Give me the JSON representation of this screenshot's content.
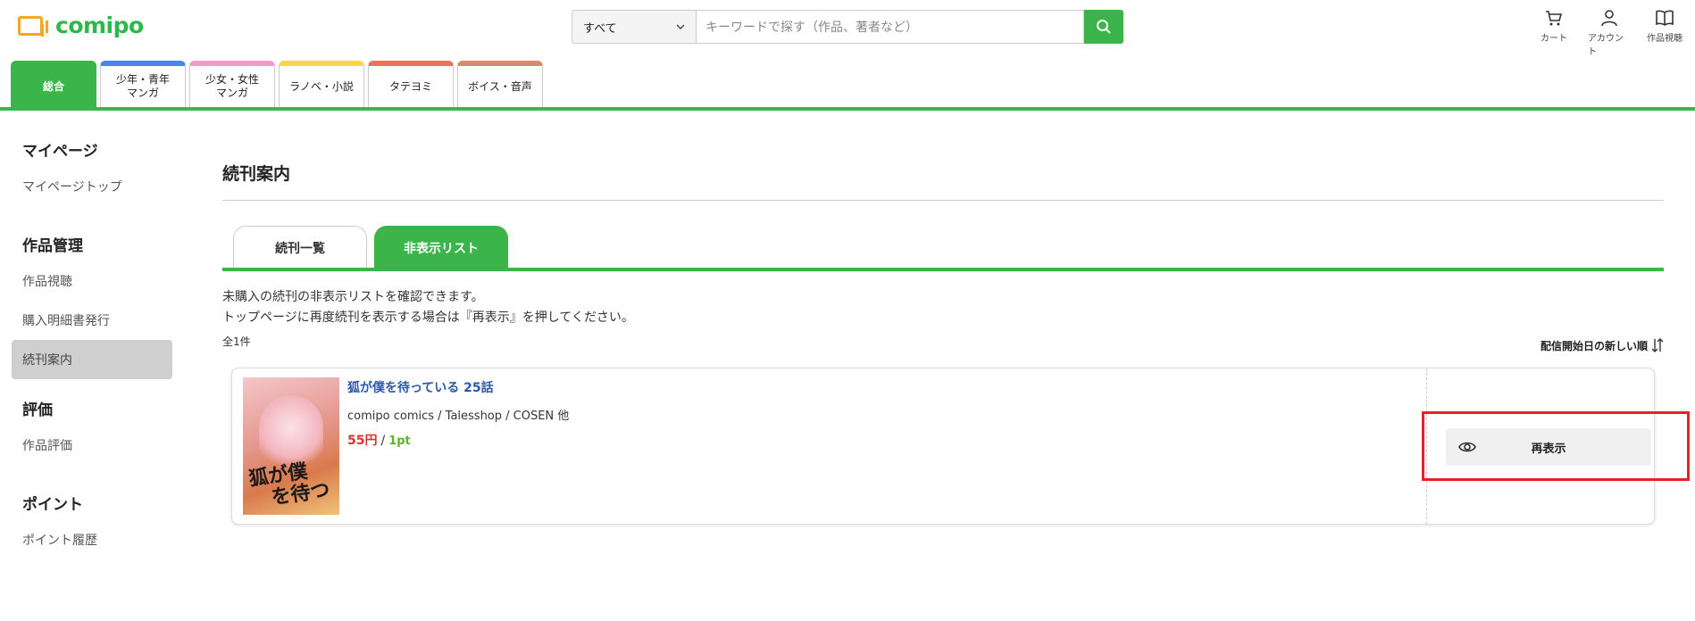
{
  "header": {
    "logo": "comipo",
    "search": {
      "select_value": "すべて",
      "placeholder": "キーワードで探す（作品、著者など）"
    },
    "icons": [
      {
        "icon": "cart-icon",
        "label": "カート"
      },
      {
        "icon": "account-icon",
        "label": "アカウント"
      },
      {
        "icon": "book-icon",
        "label": "作品視聴"
      }
    ]
  },
  "category_tabs": [
    {
      "label": "総合",
      "color": "#3bb54a"
    },
    {
      "label": "少年・青年\nマンガ",
      "color": "#4a86e8"
    },
    {
      "label": "少女・女性\nマンガ",
      "color": "#f29ac8"
    },
    {
      "label": "ラノベ・小説",
      "color": "#f6d84a"
    },
    {
      "label": "タテヨミ",
      "color": "#e8735c"
    },
    {
      "label": "ボイス・音声",
      "color": "#d98a6a"
    }
  ],
  "sidebar": {
    "sections": [
      {
        "heading": "マイページ",
        "items": [
          "マイページトップ"
        ]
      },
      {
        "heading": "作品管理",
        "items": [
          "作品視聴",
          "購入明細書発行",
          "続刊案内"
        ]
      },
      {
        "heading": "評価",
        "items": [
          "作品評価"
        ]
      },
      {
        "heading": "ポイント",
        "items": [
          "ポイント履歴"
        ]
      }
    ],
    "active_item": "続刊案内"
  },
  "main": {
    "title": "続刊案内",
    "tabs": [
      "続刊一覧",
      "非表示リスト"
    ],
    "active_tab": "非表示リスト",
    "description_line1": "未購入の続刊の非表示リストを確認できます。",
    "description_line2": "トップページに再度続刊を表示する場合は『再表示』を押してください。",
    "count": "全1件",
    "sort_label": "配信開始日の新しい順",
    "items": [
      {
        "title": "狐が僕を待っている 25話",
        "meta": "comipo comics / Talesshop / COSEN 他",
        "price_yen": "55円",
        "price_pt": "1pt",
        "cover_text": "狐が僕を待つ",
        "button_label": "再表示"
      }
    ]
  },
  "colors": {
    "accent": "#3bb54a",
    "link": "#2b5aa8",
    "price": "#e0322a",
    "point": "#5bb52a",
    "highlight": "#e8202a"
  }
}
